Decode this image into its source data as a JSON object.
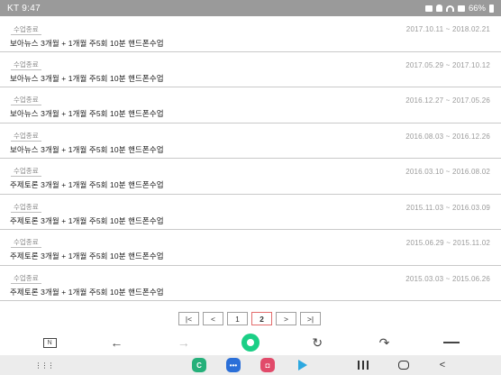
{
  "status_bar": {
    "time_carrier": "KT 9:47",
    "battery_label": "66%"
  },
  "class_history": [
    {
      "tag": "수업종료",
      "period": "2017.10.11 ~ 2018.02.21",
      "title": "보아뉴스 3개월 + 1개월 주5회 10분 핸드폰수업"
    },
    {
      "tag": "수업종료",
      "period": "2017.05.29 ~ 2017.10.12",
      "title": "보아뉴스 3개월 + 1개월 주5회 10분 핸드폰수업"
    },
    {
      "tag": "수업종료",
      "period": "2016.12.27 ~ 2017.05.26",
      "title": "보아뉴스 3개월 + 1개월 주5회 10분 핸드폰수업"
    },
    {
      "tag": "수업종료",
      "period": "2016.08.03 ~ 2016.12.26",
      "title": "보아뉴스 3개월 + 1개월 주5회 10분 핸드폰수업"
    },
    {
      "tag": "수업종료",
      "period": "2016.03.10 ~ 2016.08.02",
      "title": "주제토론 3개월 + 1개월 주5회 10분 핸드폰수업"
    },
    {
      "tag": "수업종료",
      "period": "2015.11.03 ~ 2016.03.09",
      "title": "주제토론 3개월 + 1개월 주5회 10분 핸드폰수업"
    },
    {
      "tag": "수업종료",
      "period": "2015.06.29 ~ 2015.11.02",
      "title": "주제토론 3개월 + 1개월 주5회 10분 핸드폰수업"
    },
    {
      "tag": "수업종료",
      "period": "2015.03.03 ~ 2015.06.26",
      "title": "주제토론 3개월 + 1개월 주5회 10분 핸드폰수업"
    }
  ],
  "pagination": {
    "first": "|<",
    "prev": "<",
    "pages": [
      "1",
      "2"
    ],
    "current_page": "2",
    "next": ">",
    "last": ">|"
  },
  "browser_toolbar": {
    "tabs_label": "N",
    "back": "←",
    "forward": "→",
    "reload": "↻",
    "share": "↷"
  },
  "nav_bar": {
    "apps_grid": "⋮⋮⋮",
    "back": "<"
  },
  "colors": {
    "status_bar": "#9a9a9a",
    "active_page_border": "#e26b6b",
    "accent_green": "#1bcf86",
    "row_divider": "#c9c9c9"
  }
}
